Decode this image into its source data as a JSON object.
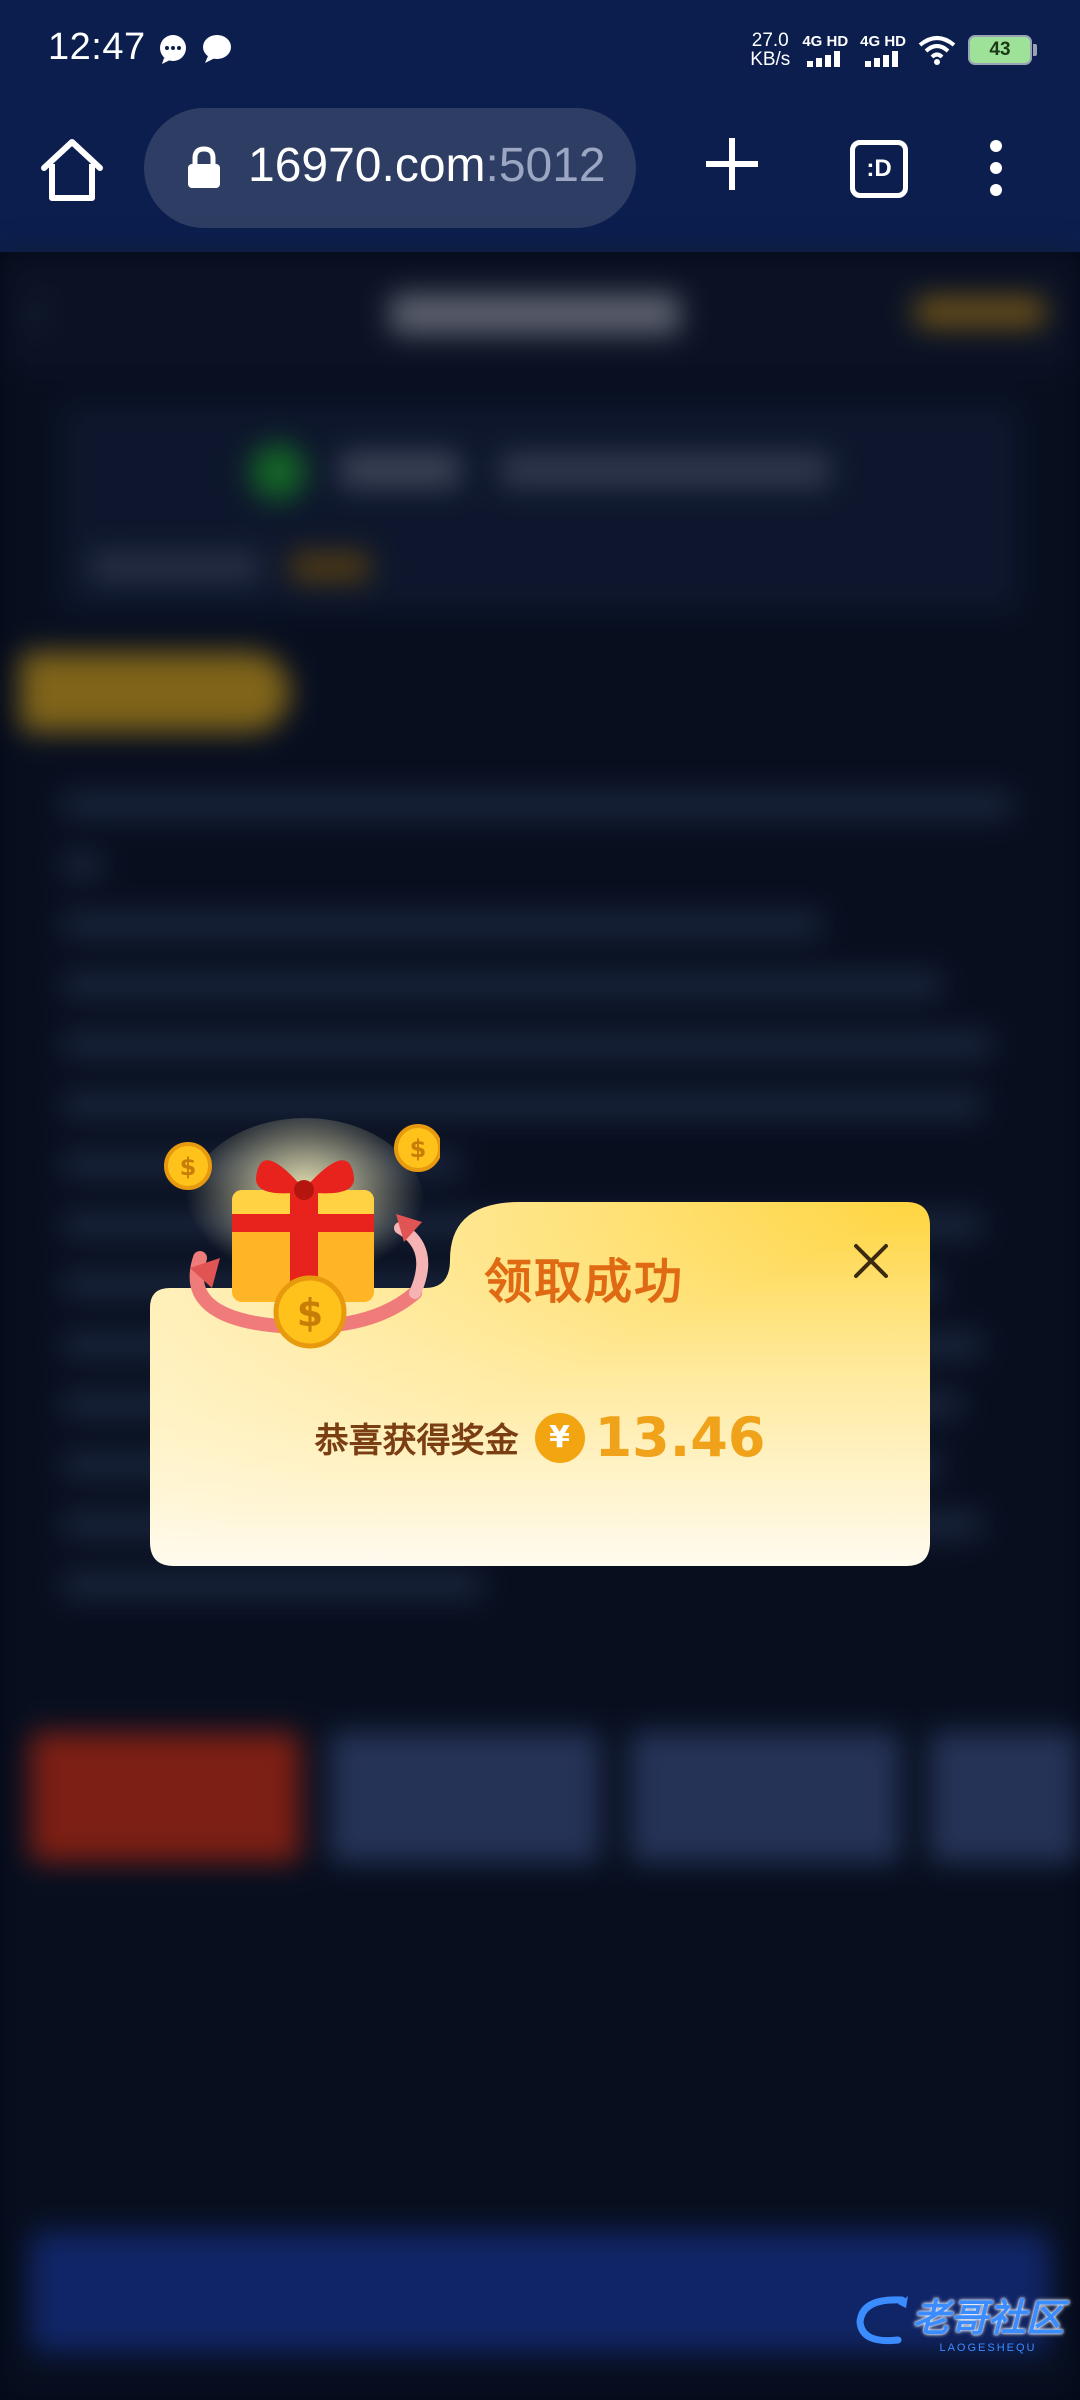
{
  "status_bar": {
    "time": "12:47",
    "net_speed_value": "27.0",
    "net_speed_unit": "KB/s",
    "sim1_label": "4G HD",
    "sim2_label": "4G HD",
    "battery": "43"
  },
  "browser": {
    "url_host": "16970.com",
    "url_port": ":5012",
    "tabs_label": ":D"
  },
  "modal": {
    "title": "领取成功",
    "reward_label": "恭喜获得奖金",
    "currency_symbol": "¥",
    "amount": "13.46"
  },
  "watermark": {
    "text": "老哥社区",
    "sub": "LAOGESHEQU"
  },
  "colors": {
    "chrome_bg": "#0b1e4e",
    "modal_title": "#e06a14",
    "amount": "#f0a21a",
    "coin": "#f2a511"
  }
}
